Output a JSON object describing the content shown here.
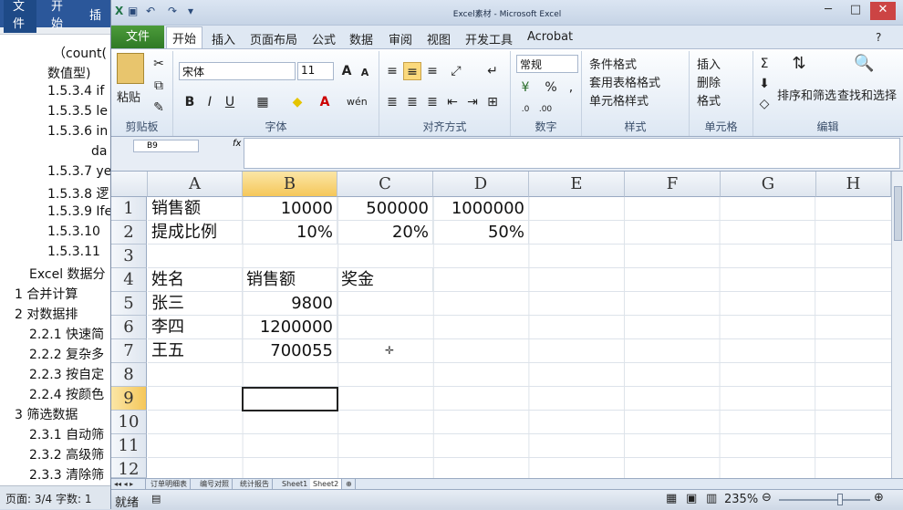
{
  "word": {
    "tabs": [
      "文件",
      "开始",
      "插"
    ],
    "lines": [
      "（count(",
      "数值型)",
      "1.5.3.4 if",
      "1.5.3.5 le",
      "1.5.3.6 in",
      "da",
      "1.5.3.7 ye",
      "1.5.3.8 逻",
      "1.5.3.9 Ife",
      "1.5.3.10",
      "1.5.3.11",
      "Excel 数据分",
      "1   合并计算",
      "2   对数据排",
      "2.2.1 快速简",
      "2.2.2 复杂多",
      "2.2.3 按自定",
      "2.2.4 按颜色",
      "3   筛选数据",
      "2.3.1 自动筛",
      "2.3.2 高级筛",
      "2.3.3 清除筛"
    ],
    "status": "页面: 3/4   字数: 1"
  },
  "excel": {
    "title": "Excel素材 - Microsoft Excel",
    "tabs": {
      "file": "文件",
      "home": "开始",
      "insert": "插入",
      "layout": "页面布局",
      "formula": "公式",
      "data": "数据",
      "review": "审阅",
      "view": "视图",
      "dev": "开发工具",
      "acrobat": "Acrobat"
    },
    "ribbon": {
      "paste": "粘贴",
      "clipboard": "剪贴板",
      "font_name": "宋体",
      "font_size": "11",
      "font": "字体",
      "align": "对齐方式",
      "numfmt": "常规",
      "number": "数字",
      "cond": "条件格式",
      "table": "套用表格格式",
      "cellstyle": "单元格样式",
      "styles": "样式",
      "ins": "插入",
      "del": "删除",
      "fmt": "格式",
      "cells": "单元格",
      "sort": "排序和筛选",
      "find": "查找和选择",
      "edit": "编辑"
    },
    "namebox": "B9",
    "fx": "fx",
    "columns": [
      "A",
      "B",
      "C",
      "D",
      "E",
      "F",
      "G",
      "H"
    ],
    "rows": [
      "1",
      "2",
      "3",
      "4",
      "5",
      "6",
      "7",
      "8",
      "9",
      "10",
      "11",
      "12"
    ],
    "cells": {
      "A1": "销售额",
      "B1": "10000",
      "C1": "500000",
      "D1": "1000000",
      "A2": "提成比例",
      "B2": "10%",
      "C2": "20%",
      "D2": "50%",
      "A4": "姓名",
      "B4": "销售额",
      "C4": "奖金",
      "A5": "张三",
      "B5": "9800",
      "A6": "李四",
      "B6": "1200000",
      "A7": "王五",
      "B7": "700055"
    },
    "sheets": [
      "订单明细表",
      "编号对照",
      "统计报告",
      "Sheet1",
      "Sheet2"
    ],
    "status": "就绪",
    "zoom": "235%"
  }
}
